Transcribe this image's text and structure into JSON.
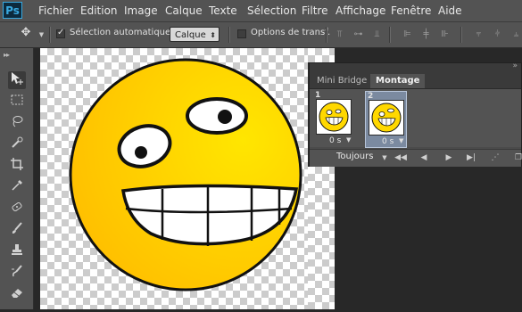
{
  "app": {
    "logo": "Ps"
  },
  "menu": [
    "Fichier",
    "Edition",
    "Image",
    "Calque",
    "Texte",
    "Sélection",
    "Filtre",
    "Affichage",
    "Fenêtre",
    "Aide"
  ],
  "options_bar": {
    "auto_select_label": "Sélection automatique :",
    "auto_select_value": "Calque",
    "transform_label": "Options de transf."
  },
  "tools": [
    "move-icon",
    "marquee-icon",
    "lasso-icon",
    "quick-select-icon",
    "crop-icon",
    "eyedropper-icon",
    "healing-icon",
    "brush-icon",
    "clone-stamp-icon",
    "history-brush-icon",
    "eraser-icon"
  ],
  "panel": {
    "tabs": [
      "Mini Bridge",
      "Montage"
    ],
    "active_tab": "Montage",
    "frames": [
      {
        "number": "1",
        "delay": "0 s"
      },
      {
        "number": "2",
        "delay": "0 s"
      }
    ],
    "loop": "Toujours"
  },
  "colors": {
    "face": "#ffd800",
    "accent": "#39a9e0"
  }
}
